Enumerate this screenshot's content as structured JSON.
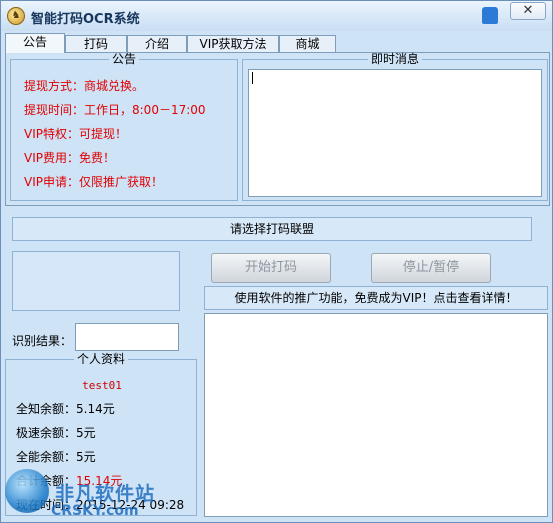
{
  "window": {
    "title": "智能打码OCR系统",
    "app_icon_glyph": "♞",
    "close_glyph": "✕"
  },
  "tabs": [
    {
      "label": "公告",
      "active": true
    },
    {
      "label": "打码",
      "active": false
    },
    {
      "label": "介绍",
      "active": false
    },
    {
      "label": "VIP获取方法",
      "active": false
    },
    {
      "label": "商城",
      "active": false
    }
  ],
  "notice": {
    "title": "公告",
    "lines": [
      "提现方式：商城兑换。",
      "提现时间：工作日，8:00－17:00",
      "VIP特权：可提现！",
      "VIP费用：免费！",
      "VIP申请：仅限推广获取！"
    ],
    "color": "#e00000"
  },
  "instant_messages": {
    "title": "即时消息"
  },
  "alliance": {
    "label": "请选择打码联盟"
  },
  "controls": {
    "start_label": "开始打码",
    "stop_label": "停止/暂停"
  },
  "promo": {
    "text": "使用软件的推广功能，免费成为VIP！点击查看详情！"
  },
  "recognition": {
    "label": "识别结果：",
    "value": ""
  },
  "profile": {
    "title": "个人资料",
    "username": "test01",
    "all_balance": "全知余额：5.14元",
    "fast_balance": "极速余额：5元",
    "full_balance": "全能余额：5元",
    "total_label": "合计余额：",
    "total_value": "15.14元",
    "time_label": "现在时间：2015-12-24 09:28"
  },
  "watermark": {
    "cn": "非凡软件站",
    "en": "CRSKY.com"
  }
}
